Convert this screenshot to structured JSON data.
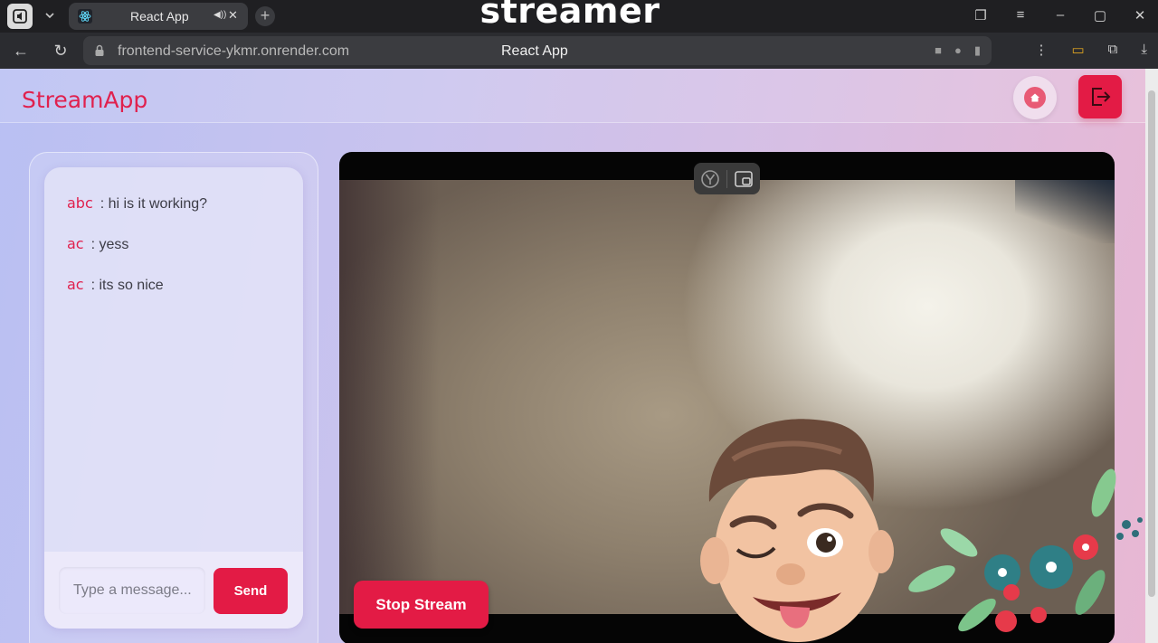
{
  "overlay_caption": "streamer",
  "browser": {
    "tab_title": "React App",
    "url": "frontend-service-ykmr.onrender.com",
    "page_title": "React App"
  },
  "app": {
    "logo": "StreamApp"
  },
  "chat": {
    "messages": [
      {
        "user": "abc",
        "text": ": hi is it working?"
      },
      {
        "user": "ac",
        "text": ": yess"
      },
      {
        "user": "ac",
        "text": ": its so nice"
      }
    ],
    "input_placeholder": "Type a message...",
    "send_label": "Send"
  },
  "video": {
    "stop_label": "Stop Stream"
  },
  "colors": {
    "accent": "#e31b45",
    "username": "#e0214e"
  }
}
